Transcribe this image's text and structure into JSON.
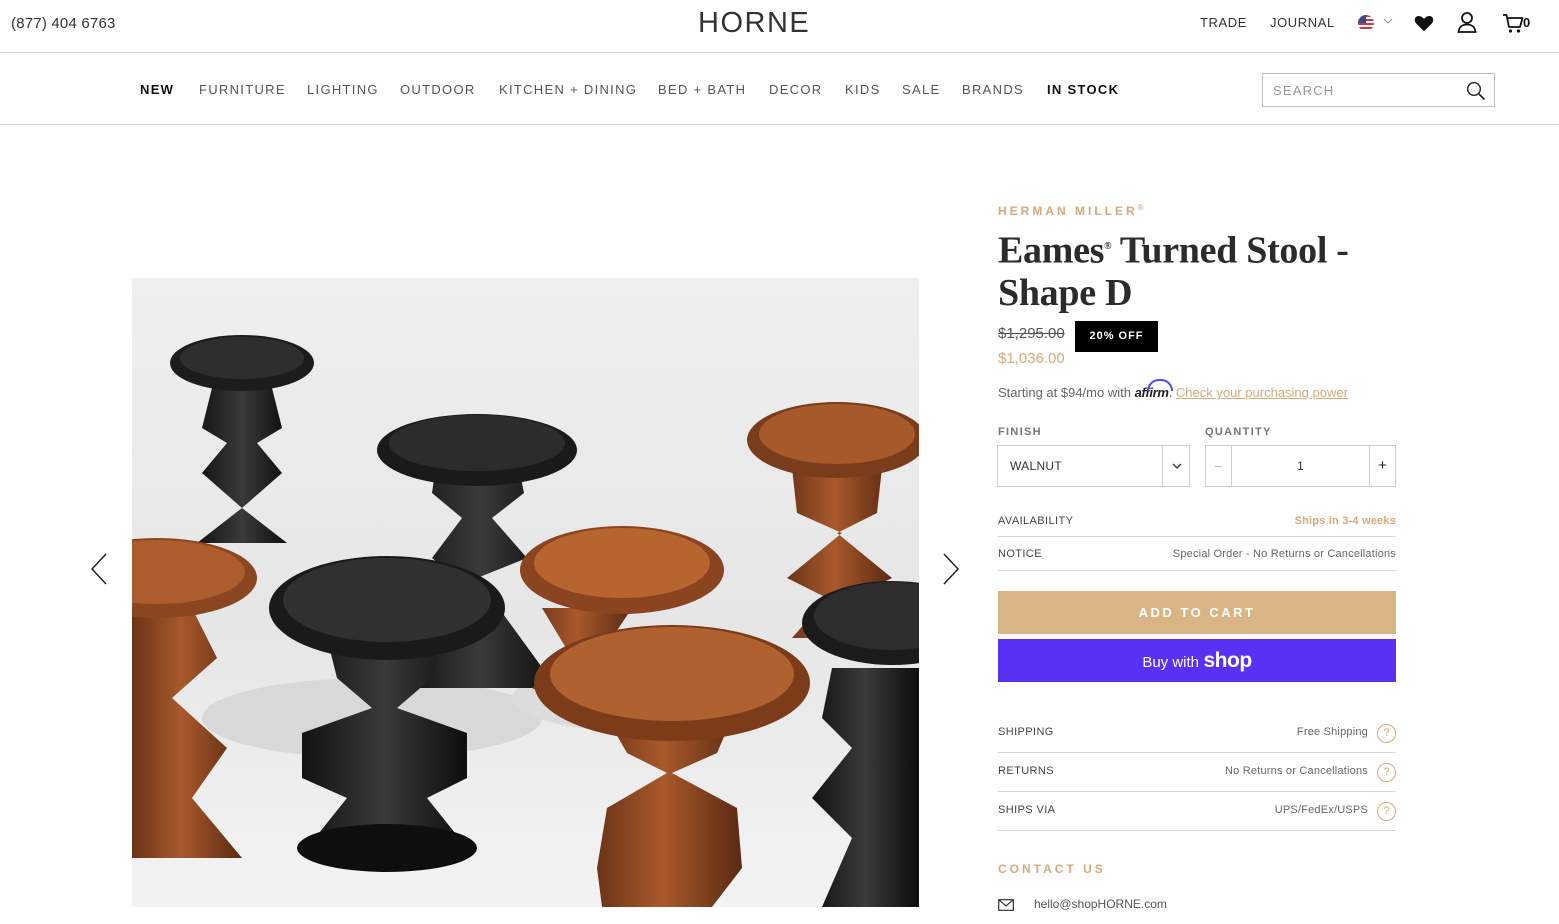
{
  "topbar": {
    "phone": "(877) 404 6763",
    "logo": "HORNE",
    "links": [
      "TRADE",
      "JOURNAL"
    ],
    "cart_count": "0"
  },
  "nav": {
    "items": [
      "NEW",
      "FURNITURE",
      "LIGHTING",
      "OUTDOOR",
      "KITCHEN + DINING",
      "BED + BATH",
      "DECOR",
      "KIDS",
      "SALE",
      "BRANDS",
      "IN STOCK"
    ],
    "search_placeholder": "SEARCH"
  },
  "product": {
    "brand": "HERMAN MILLER",
    "brand_mark": "®",
    "title_part1": "Eames",
    "title_mark": "®",
    "title_part2": " Turned Stool - Shape D",
    "old_price": "$1,295.00",
    "badge": "20% OFF",
    "price": "$1,036.00",
    "affirm_prefix": "Starting at $94/mo with",
    "affirm_logo": "affirm",
    "affirm_link": "Check your purchasing power",
    "finish_label": "FINISH",
    "finish_value": "WALNUT",
    "quantity_label": "QUANTITY",
    "quantity_value": "1",
    "quantity_minus": "−",
    "quantity_plus": "+",
    "availability_label": "AVAILABILITY",
    "availability_value": "Ships in 3-4 weeks",
    "notice_label": "NOTICE",
    "notice_value": "Special Order - No Returns or Cancellations",
    "add_to_cart": "ADD TO CART",
    "buy_with": "Buy with",
    "shop": "shop",
    "shipping_label": "SHIPPING",
    "shipping_value": "Free Shipping",
    "returns_label": "RETURNS",
    "returns_value": "No Returns or Cancellations",
    "ships_via_label": "SHIPS VIA",
    "ships_via_value": "UPS/FedEx/USPS",
    "help": "?",
    "contact_heading": "CONTACT US",
    "email": "hello@shopHORNE.com"
  },
  "colors": {
    "accent": "#d9a979",
    "cart_button": "#d9b586",
    "shop_pay": "#5a31f4",
    "badge": "#000000"
  },
  "icons": [
    "us-flag-icon",
    "chevron-down-icon",
    "heart-icon",
    "user-icon",
    "cart-icon",
    "search-icon",
    "chevron-left-icon",
    "chevron-right-icon",
    "mail-icon"
  ]
}
